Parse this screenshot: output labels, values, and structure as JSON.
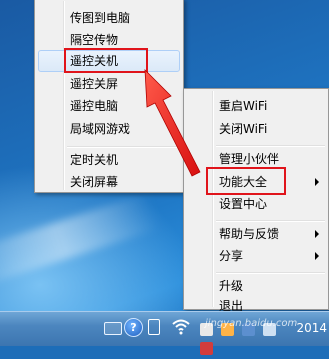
{
  "left_menu": {
    "items": [
      {
        "label": "传图到电脑"
      },
      {
        "label": "隔空传物"
      },
      {
        "label": "遥控关机"
      },
      {
        "label": "遥控关屏"
      },
      {
        "label": "遥控电脑"
      },
      {
        "label": "局域网游戏"
      },
      {
        "label": "定时关机"
      },
      {
        "label": "关闭屏幕"
      }
    ]
  },
  "right_menu": {
    "items": [
      {
        "label": "重启WiFi"
      },
      {
        "label": "关闭WiFi"
      },
      {
        "label": "管理小伙伴"
      },
      {
        "label": "功能大全"
      },
      {
        "label": "设置中心"
      },
      {
        "label": "帮助与反馈"
      },
      {
        "label": "分享"
      },
      {
        "label": "升级"
      },
      {
        "label": "退出"
      }
    ]
  },
  "taskbar": {
    "clock_text": "2014",
    "help_glyph": "?",
    "watermark": "jingyan.baidu.com"
  },
  "annotation": {
    "color": "#e0141b"
  }
}
